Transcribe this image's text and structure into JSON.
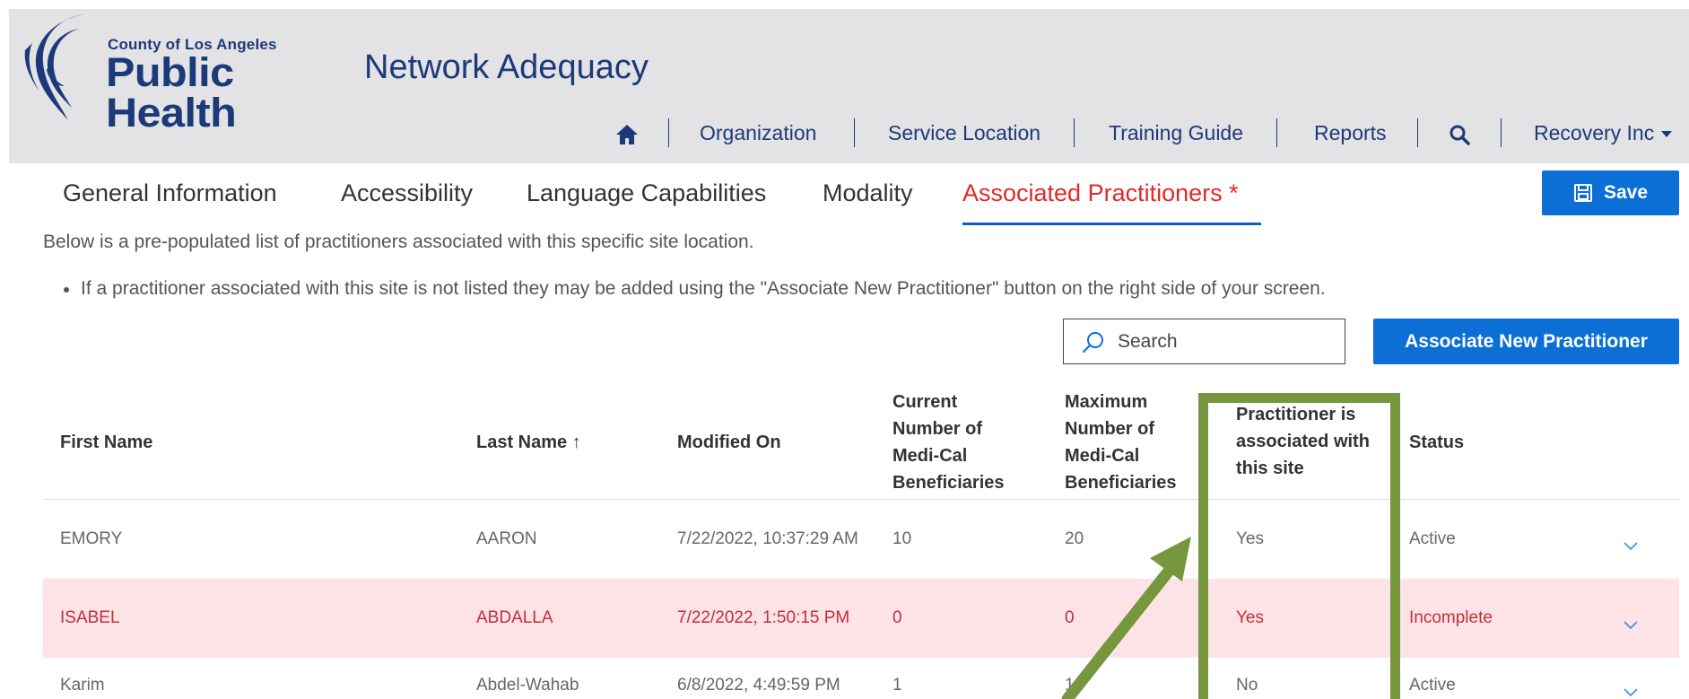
{
  "header": {
    "logo_small": "County of Los Angeles",
    "logo_big": "Public Health",
    "app_title": "Network Adequacy",
    "nav": [
      "Organization",
      "Service Location",
      "Training Guide",
      "Reports"
    ],
    "user_menu": "Recovery Inc"
  },
  "tabs": [
    "General Information",
    "Accessibility",
    "Language Capabilities",
    "Modality",
    "Associated Practitioners *"
  ],
  "active_tab": "Associated Practitioners *",
  "save_label": "Save",
  "intro_text": "Below is a pre-populated list of practitioners associated with this specific site location.",
  "bullet_text": "If a practitioner associated with this site is not listed they may be added using the \"Associate New Practitioner\" button on the right side of your screen.",
  "search": {
    "placeholder": "Search"
  },
  "associate_button": "Associate New Practitioner",
  "table": {
    "columns": {
      "first_name": "First Name",
      "last_name": "Last Name ↑",
      "modified_on": "Modified On",
      "current_1": "Current",
      "current_2": "Number of",
      "current_3": "Medi-Cal",
      "current_4": "Beneficiaries",
      "max_1": "Maximum",
      "max_2": "Number of",
      "max_3": "Medi-Cal",
      "max_4": "Beneficiaries",
      "assoc_1": "Practitioner is",
      "assoc_2": "associated with",
      "assoc_3": "this site",
      "status": "Status"
    },
    "rows": [
      {
        "first": "EMORY",
        "last": "AARON",
        "modified": "7/22/2022, 10:37:29 AM",
        "current": "10",
        "max": "20",
        "assoc": "Yes",
        "status": "Active"
      },
      {
        "first": "ISABEL",
        "last": "ABDALLA",
        "modified": "7/22/2022, 1:50:15 PM",
        "current": "0",
        "max": "0",
        "assoc": "Yes",
        "status": "Incomplete"
      },
      {
        "first": "Karim",
        "last": "Abdel-Wahab",
        "modified": "6/8/2022, 4:49:59 PM",
        "current": "1",
        "max": "1",
        "assoc": "No",
        "status": "Active"
      }
    ]
  },
  "colors": {
    "brand": "#1c3a79",
    "accent": "#0b6fd6",
    "active_tab": "#e32929",
    "error_row": "#fde3e6",
    "annotation": "#76973d"
  }
}
